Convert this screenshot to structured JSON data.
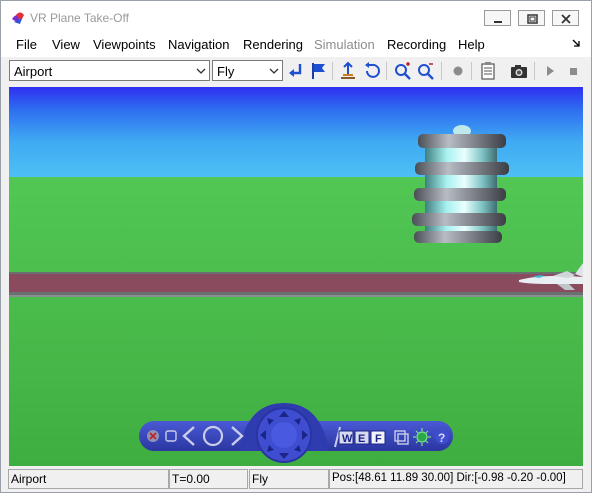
{
  "window": {
    "title": "VR Plane Take-Off",
    "controls": [
      "minimize-icon",
      "maximize-icon",
      "close-icon"
    ]
  },
  "menu": {
    "items": [
      {
        "label": "File",
        "enabled": true
      },
      {
        "label": "View",
        "enabled": true
      },
      {
        "label": "Viewpoints",
        "enabled": true
      },
      {
        "label": "Navigation",
        "enabled": true
      },
      {
        "label": "Rendering",
        "enabled": true
      },
      {
        "label": "Simulation",
        "enabled": false
      },
      {
        "label": "Recording",
        "enabled": true
      },
      {
        "label": "Help",
        "enabled": true
      }
    ]
  },
  "toolbar": {
    "viewpoint_select": "Airport",
    "navigation_select": "Fly",
    "icons": [
      "return-to-viewpoint-icon",
      "create-viewpoint-icon",
      "straighten-up-icon",
      "undo-move-icon",
      "zoom-in-icon",
      "zoom-out-icon",
      "record-icon",
      "capture-settings-icon",
      "camera-icon",
      "play-icon",
      "stop-icon"
    ]
  },
  "scene": {
    "sky_color": "#4ec0f5",
    "ground_color": "#52c754",
    "runway_color": "#8a4b5e"
  },
  "nav_panel": {
    "buttons": [
      "close-panel-icon",
      "minimize-panel-icon",
      "previous-viewpoint-icon",
      "go-home-icon",
      "next-viewpoint-icon",
      "navigation-wheel-icon",
      "walk-mode-icon",
      "examine-mode-icon",
      "fly-mode-icon",
      "straighten-icon",
      "headlight-icon",
      "help-icon"
    ],
    "mode_labels": {
      "walk": "W",
      "examine": "E",
      "fly": "F"
    }
  },
  "status": {
    "viewpoint": "Airport",
    "time": "T=0.00",
    "mode": "Fly",
    "position": "Pos:[48.61 11.89 30.00] Dir:[-0.98 -0.20 -0.00]"
  }
}
